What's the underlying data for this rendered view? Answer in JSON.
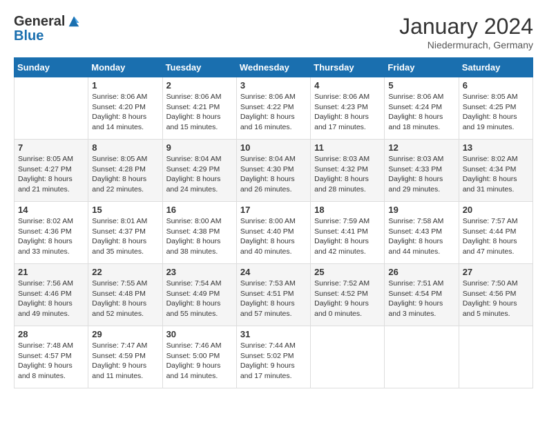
{
  "header": {
    "logo_general": "General",
    "logo_blue": "Blue",
    "month_year": "January 2024",
    "location": "Niedermurach, Germany"
  },
  "weekdays": [
    "Sunday",
    "Monday",
    "Tuesday",
    "Wednesday",
    "Thursday",
    "Friday",
    "Saturday"
  ],
  "weeks": [
    [
      {
        "day": "",
        "sunrise": "",
        "sunset": "",
        "daylight": ""
      },
      {
        "day": "1",
        "sunrise": "Sunrise: 8:06 AM",
        "sunset": "Sunset: 4:20 PM",
        "daylight": "Daylight: 8 hours and 14 minutes."
      },
      {
        "day": "2",
        "sunrise": "Sunrise: 8:06 AM",
        "sunset": "Sunset: 4:21 PM",
        "daylight": "Daylight: 8 hours and 15 minutes."
      },
      {
        "day": "3",
        "sunrise": "Sunrise: 8:06 AM",
        "sunset": "Sunset: 4:22 PM",
        "daylight": "Daylight: 8 hours and 16 minutes."
      },
      {
        "day": "4",
        "sunrise": "Sunrise: 8:06 AM",
        "sunset": "Sunset: 4:23 PM",
        "daylight": "Daylight: 8 hours and 17 minutes."
      },
      {
        "day": "5",
        "sunrise": "Sunrise: 8:06 AM",
        "sunset": "Sunset: 4:24 PM",
        "daylight": "Daylight: 8 hours and 18 minutes."
      },
      {
        "day": "6",
        "sunrise": "Sunrise: 8:05 AM",
        "sunset": "Sunset: 4:25 PM",
        "daylight": "Daylight: 8 hours and 19 minutes."
      }
    ],
    [
      {
        "day": "7",
        "sunrise": "Sunrise: 8:05 AM",
        "sunset": "Sunset: 4:27 PM",
        "daylight": "Daylight: 8 hours and 21 minutes."
      },
      {
        "day": "8",
        "sunrise": "Sunrise: 8:05 AM",
        "sunset": "Sunset: 4:28 PM",
        "daylight": "Daylight: 8 hours and 22 minutes."
      },
      {
        "day": "9",
        "sunrise": "Sunrise: 8:04 AM",
        "sunset": "Sunset: 4:29 PM",
        "daylight": "Daylight: 8 hours and 24 minutes."
      },
      {
        "day": "10",
        "sunrise": "Sunrise: 8:04 AM",
        "sunset": "Sunset: 4:30 PM",
        "daylight": "Daylight: 8 hours and 26 minutes."
      },
      {
        "day": "11",
        "sunrise": "Sunrise: 8:03 AM",
        "sunset": "Sunset: 4:32 PM",
        "daylight": "Daylight: 8 hours and 28 minutes."
      },
      {
        "day": "12",
        "sunrise": "Sunrise: 8:03 AM",
        "sunset": "Sunset: 4:33 PM",
        "daylight": "Daylight: 8 hours and 29 minutes."
      },
      {
        "day": "13",
        "sunrise": "Sunrise: 8:02 AM",
        "sunset": "Sunset: 4:34 PM",
        "daylight": "Daylight: 8 hours and 31 minutes."
      }
    ],
    [
      {
        "day": "14",
        "sunrise": "Sunrise: 8:02 AM",
        "sunset": "Sunset: 4:36 PM",
        "daylight": "Daylight: 8 hours and 33 minutes."
      },
      {
        "day": "15",
        "sunrise": "Sunrise: 8:01 AM",
        "sunset": "Sunset: 4:37 PM",
        "daylight": "Daylight: 8 hours and 35 minutes."
      },
      {
        "day": "16",
        "sunrise": "Sunrise: 8:00 AM",
        "sunset": "Sunset: 4:38 PM",
        "daylight": "Daylight: 8 hours and 38 minutes."
      },
      {
        "day": "17",
        "sunrise": "Sunrise: 8:00 AM",
        "sunset": "Sunset: 4:40 PM",
        "daylight": "Daylight: 8 hours and 40 minutes."
      },
      {
        "day": "18",
        "sunrise": "Sunrise: 7:59 AM",
        "sunset": "Sunset: 4:41 PM",
        "daylight": "Daylight: 8 hours and 42 minutes."
      },
      {
        "day": "19",
        "sunrise": "Sunrise: 7:58 AM",
        "sunset": "Sunset: 4:43 PM",
        "daylight": "Daylight: 8 hours and 44 minutes."
      },
      {
        "day": "20",
        "sunrise": "Sunrise: 7:57 AM",
        "sunset": "Sunset: 4:44 PM",
        "daylight": "Daylight: 8 hours and 47 minutes."
      }
    ],
    [
      {
        "day": "21",
        "sunrise": "Sunrise: 7:56 AM",
        "sunset": "Sunset: 4:46 PM",
        "daylight": "Daylight: 8 hours and 49 minutes."
      },
      {
        "day": "22",
        "sunrise": "Sunrise: 7:55 AM",
        "sunset": "Sunset: 4:48 PM",
        "daylight": "Daylight: 8 hours and 52 minutes."
      },
      {
        "day": "23",
        "sunrise": "Sunrise: 7:54 AM",
        "sunset": "Sunset: 4:49 PM",
        "daylight": "Daylight: 8 hours and 55 minutes."
      },
      {
        "day": "24",
        "sunrise": "Sunrise: 7:53 AM",
        "sunset": "Sunset: 4:51 PM",
        "daylight": "Daylight: 8 hours and 57 minutes."
      },
      {
        "day": "25",
        "sunrise": "Sunrise: 7:52 AM",
        "sunset": "Sunset: 4:52 PM",
        "daylight": "Daylight: 9 hours and 0 minutes."
      },
      {
        "day": "26",
        "sunrise": "Sunrise: 7:51 AM",
        "sunset": "Sunset: 4:54 PM",
        "daylight": "Daylight: 9 hours and 3 minutes."
      },
      {
        "day": "27",
        "sunrise": "Sunrise: 7:50 AM",
        "sunset": "Sunset: 4:56 PM",
        "daylight": "Daylight: 9 hours and 5 minutes."
      }
    ],
    [
      {
        "day": "28",
        "sunrise": "Sunrise: 7:48 AM",
        "sunset": "Sunset: 4:57 PM",
        "daylight": "Daylight: 9 hours and 8 minutes."
      },
      {
        "day": "29",
        "sunrise": "Sunrise: 7:47 AM",
        "sunset": "Sunset: 4:59 PM",
        "daylight": "Daylight: 9 hours and 11 minutes."
      },
      {
        "day": "30",
        "sunrise": "Sunrise: 7:46 AM",
        "sunset": "Sunset: 5:00 PM",
        "daylight": "Daylight: 9 hours and 14 minutes."
      },
      {
        "day": "31",
        "sunrise": "Sunrise: 7:44 AM",
        "sunset": "Sunset: 5:02 PM",
        "daylight": "Daylight: 9 hours and 17 minutes."
      },
      {
        "day": "",
        "sunrise": "",
        "sunset": "",
        "daylight": ""
      },
      {
        "day": "",
        "sunrise": "",
        "sunset": "",
        "daylight": ""
      },
      {
        "day": "",
        "sunrise": "",
        "sunset": "",
        "daylight": ""
      }
    ]
  ]
}
